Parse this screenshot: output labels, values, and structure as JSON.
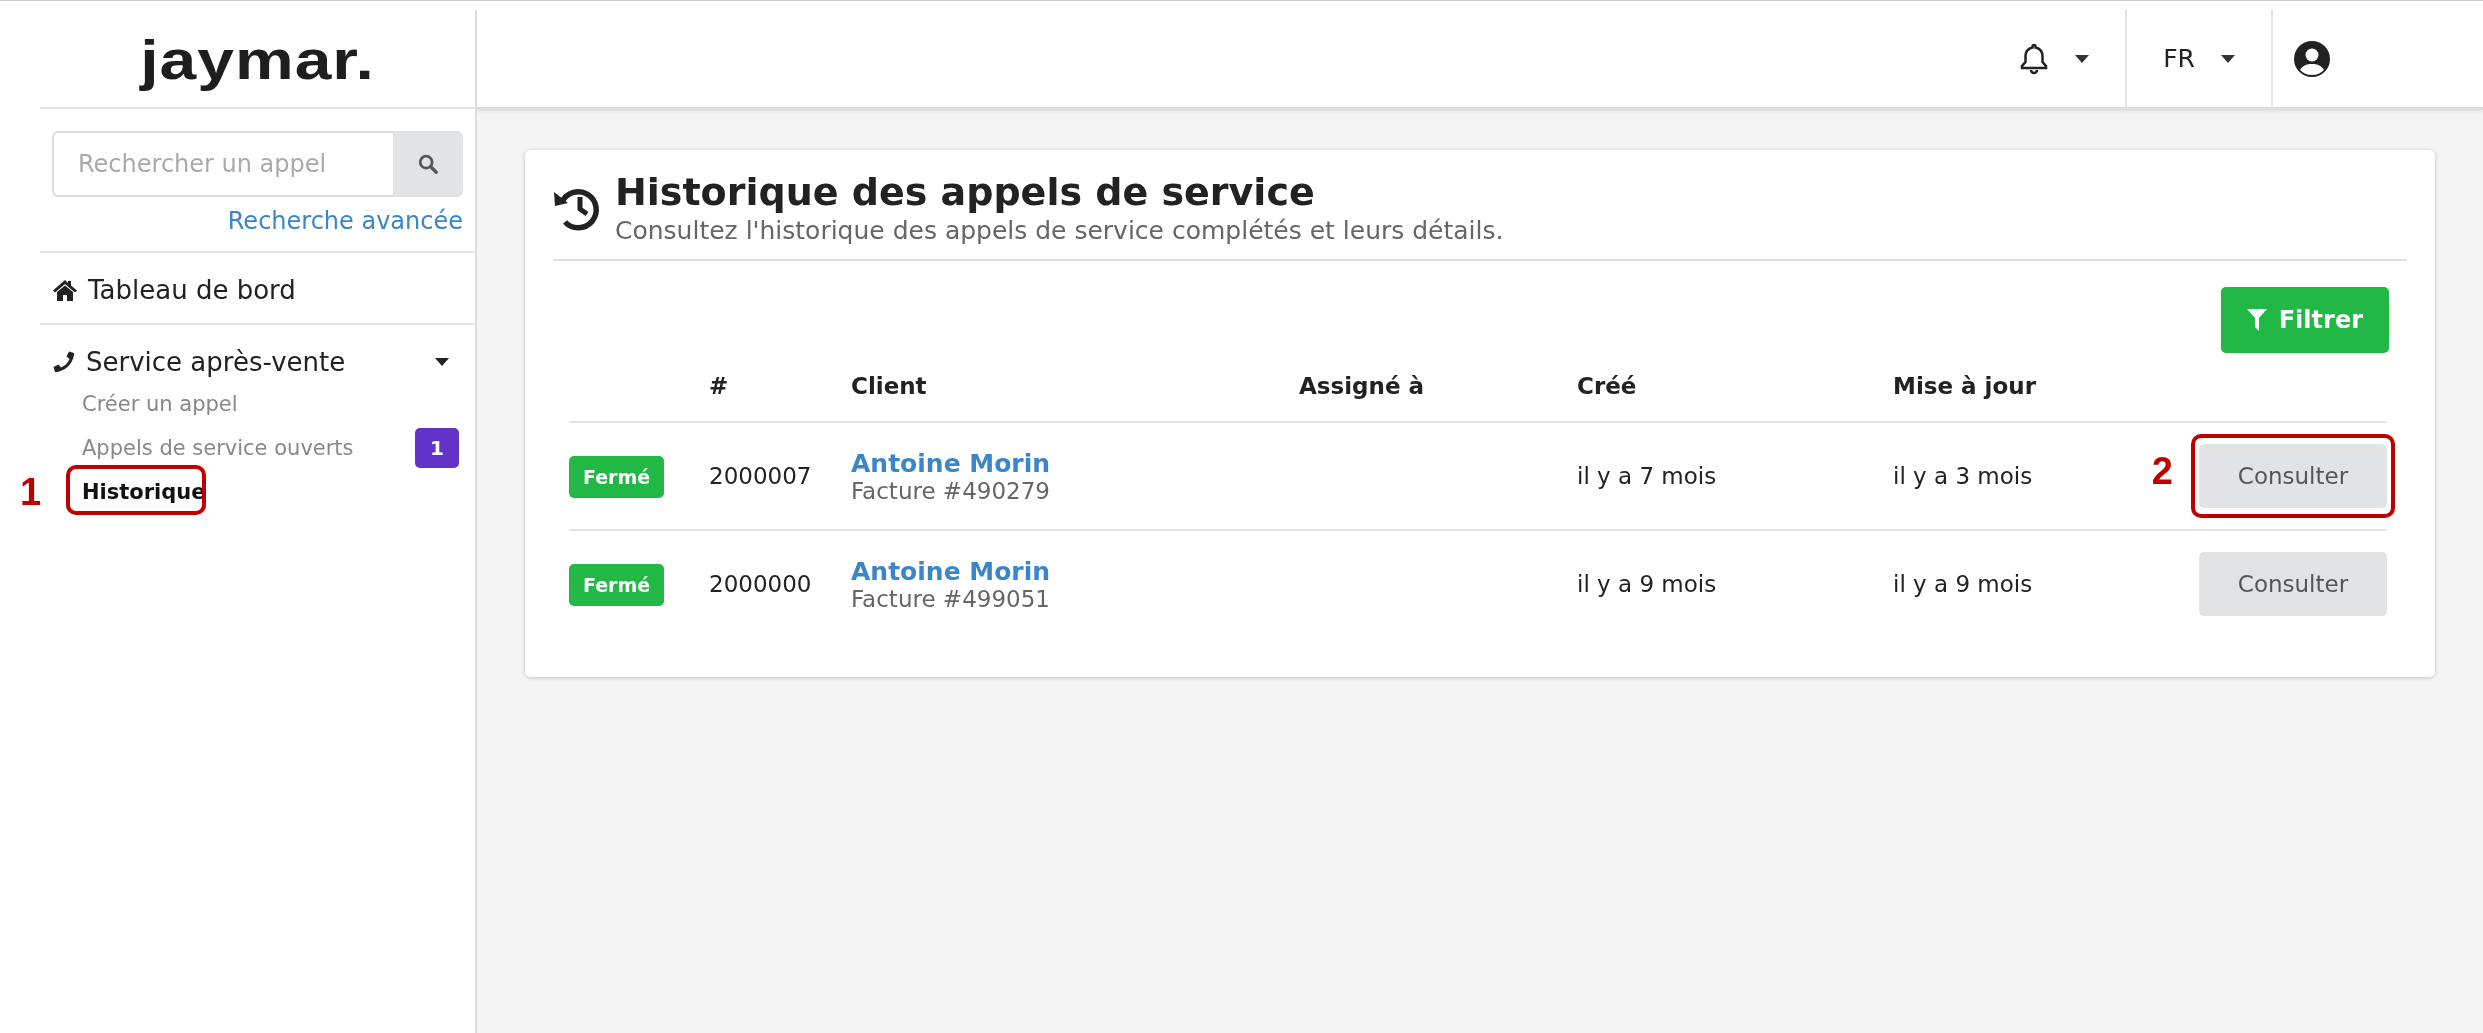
{
  "logo": {
    "text": "jaymar."
  },
  "header": {
    "language": "FR"
  },
  "sidebar": {
    "search": {
      "placeholder": "Rechercher un appel"
    },
    "advanced_link": "Recherche avancée",
    "items": [
      {
        "label": "Tableau de bord",
        "kind": "home"
      },
      {
        "label": "Service après-vente",
        "kind": "phone",
        "expanded": true,
        "children": [
          {
            "label": "Créer un appel",
            "selected": false
          },
          {
            "label": "Appels de service ouverts",
            "selected": false,
            "badge": "1"
          },
          {
            "label": "Historique",
            "selected": true,
            "annotation": "1"
          }
        ]
      }
    ]
  },
  "page": {
    "title": "Historique des appels de service",
    "subtitle": "Consultez l'historique des appels de service complétés et leurs détails."
  },
  "filter_button": "Filtrer",
  "table": {
    "columns": [
      "#",
      "Client",
      "Assigné à",
      "Créé",
      "Mise à jour"
    ],
    "rows": [
      {
        "status": "Fermé",
        "number": "2000007",
        "client": "Antoine Morin",
        "invoice": "Facture #490279",
        "created": "il y a 7 mois",
        "updated": "il y a 3 mois",
        "action": "Consulter",
        "annotation": "2"
      },
      {
        "status": "Fermé",
        "number": "2000000",
        "client": "Antoine Morin",
        "invoice": "Facture #499051",
        "created": "il y a 9 mois",
        "updated": "il y a 9 mois",
        "action": "Consulter"
      }
    ]
  }
}
